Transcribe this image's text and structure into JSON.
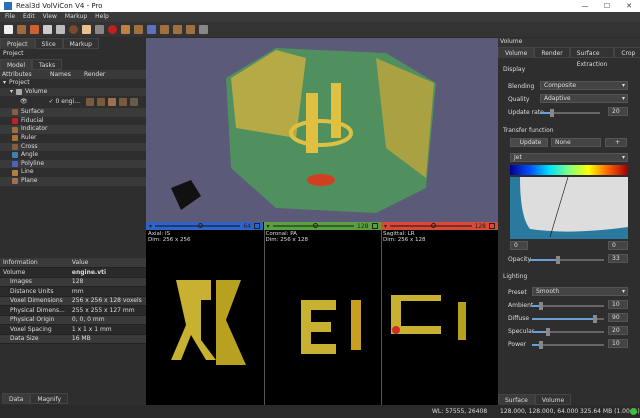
{
  "window": {
    "title": "Real3d VolViCon V4 - Pro",
    "min": "—",
    "max": "☐",
    "close": "✕"
  },
  "menu": [
    "File",
    "Edit",
    "View",
    "Markup",
    "Help"
  ],
  "left": {
    "tabs": [
      "Project",
      "Slice",
      "Markup"
    ],
    "panel_title": "Project",
    "subtabs": [
      "Model",
      "Tasks"
    ],
    "columns": [
      "Attributes",
      "Names",
      "Render"
    ],
    "tree_root": "Project",
    "volume": "Volume",
    "volume_name": "✓ 0 engi...",
    "items": [
      {
        "label": "Surface",
        "color": "#8a5a4a"
      },
      {
        "label": "Fiducial",
        "color": "#c02020"
      },
      {
        "label": "Indicator",
        "color": "#9a7040"
      },
      {
        "label": "Ruler",
        "color": "#b07030"
      },
      {
        "label": "Cross",
        "color": "#806040"
      },
      {
        "label": "Angle",
        "color": "#4080b0"
      },
      {
        "label": "Polyline",
        "color": "#5060c0"
      },
      {
        "label": "Line",
        "color": "#b08040"
      },
      {
        "label": "Plane",
        "color": "#a07050"
      }
    ],
    "info_headers": [
      "Information",
      "Value"
    ],
    "info_volume": {
      "k": "Volume",
      "v": "engine.vti"
    },
    "info": [
      {
        "k": "Images",
        "v": "128"
      },
      {
        "k": "Distance Units",
        "v": "mm"
      },
      {
        "k": "Voxel Dimensions",
        "v": "256 x 256 x 128 voxels"
      },
      {
        "k": "Physical Dimens...",
        "v": "255 x 255 x 127 mm"
      },
      {
        "k": "Physical Origin",
        "v": "0, 0, 0 mm"
      },
      {
        "k": "Voxel Spacing",
        "v": "1 x 1 x 1 mm"
      },
      {
        "k": "Data Size",
        "v": "16 MB"
      }
    ],
    "bottom_tabs": [
      "Data",
      "Magnify"
    ]
  },
  "slices": [
    {
      "name": "Axial: IS",
      "dim": "Dim: 256 x 256",
      "value": "64",
      "color": "#2f63c8",
      "pos": 0.5
    },
    {
      "name": "Coronal: PA",
      "dim": "Dim: 256 x 128",
      "value": "128",
      "color": "#5aa040",
      "pos": 0.5
    },
    {
      "name": "Sagittal: LR",
      "dim": "Dim: 256 x 128",
      "value": "128",
      "color": "#d84a38",
      "pos": 0.5
    }
  ],
  "right": {
    "panel_title": "Volume",
    "tabs": [
      "Volume",
      "Render",
      "Surface Extraction",
      "Crop"
    ],
    "display": "Display",
    "blending_label": "Blending",
    "blending": "Composite",
    "quality_label": "Quality",
    "quality": "Adaptive",
    "update_rate_label": "Update rate",
    "update_rate": "20",
    "tf": "Transfer function",
    "update_btn": "Update",
    "preset_none": "None",
    "plus": "+",
    "colormap": "Jet",
    "min": "0",
    "max": "0",
    "opacity_label": "Opacity",
    "opacity": "33",
    "lighting": "Lighting",
    "preset_label": "Preset",
    "preset": "Smooth",
    "ambient_label": "Ambient",
    "ambient": "10",
    "diffuse_label": "Diffuse",
    "diffuse": "90",
    "specular_label": "Specular",
    "specular": "20",
    "power_label": "Power",
    "power": "10",
    "bottom_tabs": [
      "Surface",
      "Volume"
    ]
  },
  "status": {
    "wl": "WL: 57555, 26408",
    "coords": "128.000, 128.000, 64.000",
    "memory": "325.64 MB (1.00 %)",
    "ok_color": "#3cc03c"
  }
}
